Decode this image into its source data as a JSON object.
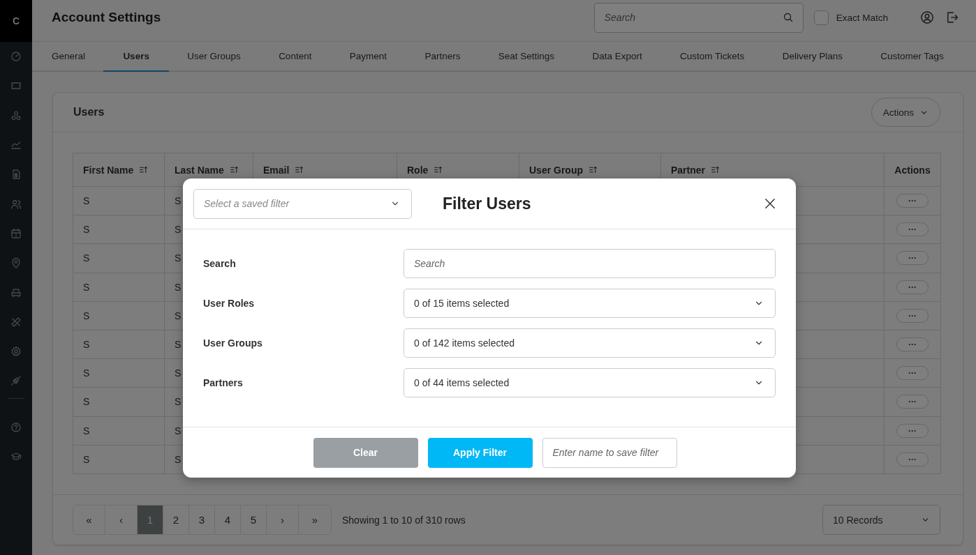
{
  "sidebar": {
    "logo": "C"
  },
  "header": {
    "title": "Account Settings",
    "search": {
      "placeholder": "Search"
    },
    "exact_match": {
      "label": "Exact Match",
      "checked": false
    }
  },
  "tabs": [
    {
      "label": "General",
      "selected": false
    },
    {
      "label": "Users",
      "selected": true
    },
    {
      "label": "User Groups",
      "selected": false
    },
    {
      "label": "Content",
      "selected": false
    },
    {
      "label": "Payment",
      "selected": false
    },
    {
      "label": "Partners",
      "selected": false
    },
    {
      "label": "Seat Settings",
      "selected": false
    },
    {
      "label": "Data Export",
      "selected": false
    },
    {
      "label": "Custom Tickets",
      "selected": false
    },
    {
      "label": "Delivery Plans",
      "selected": false
    },
    {
      "label": "Customer Tags",
      "selected": false
    }
  ],
  "users_card": {
    "title": "Users",
    "actions_button": "Actions",
    "table": {
      "columns": [
        {
          "label": "First Name",
          "sortable": true
        },
        {
          "label": "Last Name",
          "sortable": true
        },
        {
          "label": "Email",
          "sortable": true
        },
        {
          "label": "Role",
          "sortable": true
        },
        {
          "label": "User Group",
          "sortable": true
        },
        {
          "label": "Partner",
          "sortable": true
        },
        {
          "label": "Actions",
          "sortable": false
        }
      ],
      "rows": [
        {
          "first_name": "S",
          "last_name": "S",
          "actions": "···"
        },
        {
          "first_name": "S",
          "last_name": "S",
          "actions": "···"
        },
        {
          "first_name": "S",
          "last_name": "S",
          "actions": "···"
        },
        {
          "first_name": "S",
          "last_name": "S",
          "actions": "···"
        },
        {
          "first_name": "S",
          "last_name": "S",
          "actions": "···"
        },
        {
          "first_name": "S",
          "last_name": "S",
          "actions": "···"
        },
        {
          "first_name": "S",
          "last_name": "S",
          "actions": "···"
        },
        {
          "first_name": "S",
          "last_name": "S",
          "actions": "···"
        },
        {
          "first_name": "S",
          "last_name": "S",
          "actions": "···"
        },
        {
          "first_name": "S",
          "last_name": "S",
          "actions": "···"
        }
      ]
    },
    "pagination": {
      "first": "«",
      "previous": "‹",
      "pages": [
        {
          "label": "1",
          "selected": true
        },
        {
          "label": "2",
          "selected": false
        },
        {
          "label": "3",
          "selected": false
        },
        {
          "label": "4",
          "selected": false
        },
        {
          "label": "5",
          "selected": false
        }
      ],
      "next": "›",
      "last": "»",
      "summary": "Showing 1 to 10 of 310 rows",
      "page_size": "10 Records"
    }
  },
  "filter_modal": {
    "saved_filter": {
      "placeholder": "Select a saved filter"
    },
    "title": "Filter Users",
    "fields": [
      {
        "kind": "text",
        "label": "Search",
        "placeholder": "Search"
      },
      {
        "kind": "select",
        "label": "User Roles",
        "value": "0 of 15 items selected"
      },
      {
        "kind": "select",
        "label": "User Groups",
        "value": "0 of 142 items selected"
      },
      {
        "kind": "select",
        "label": "Partners",
        "value": "0 of 44 items selected"
      }
    ],
    "clear_button": "Clear",
    "apply_button": "Apply Filter",
    "filter_name": {
      "placeholder": "Enter name to save filter"
    }
  }
}
